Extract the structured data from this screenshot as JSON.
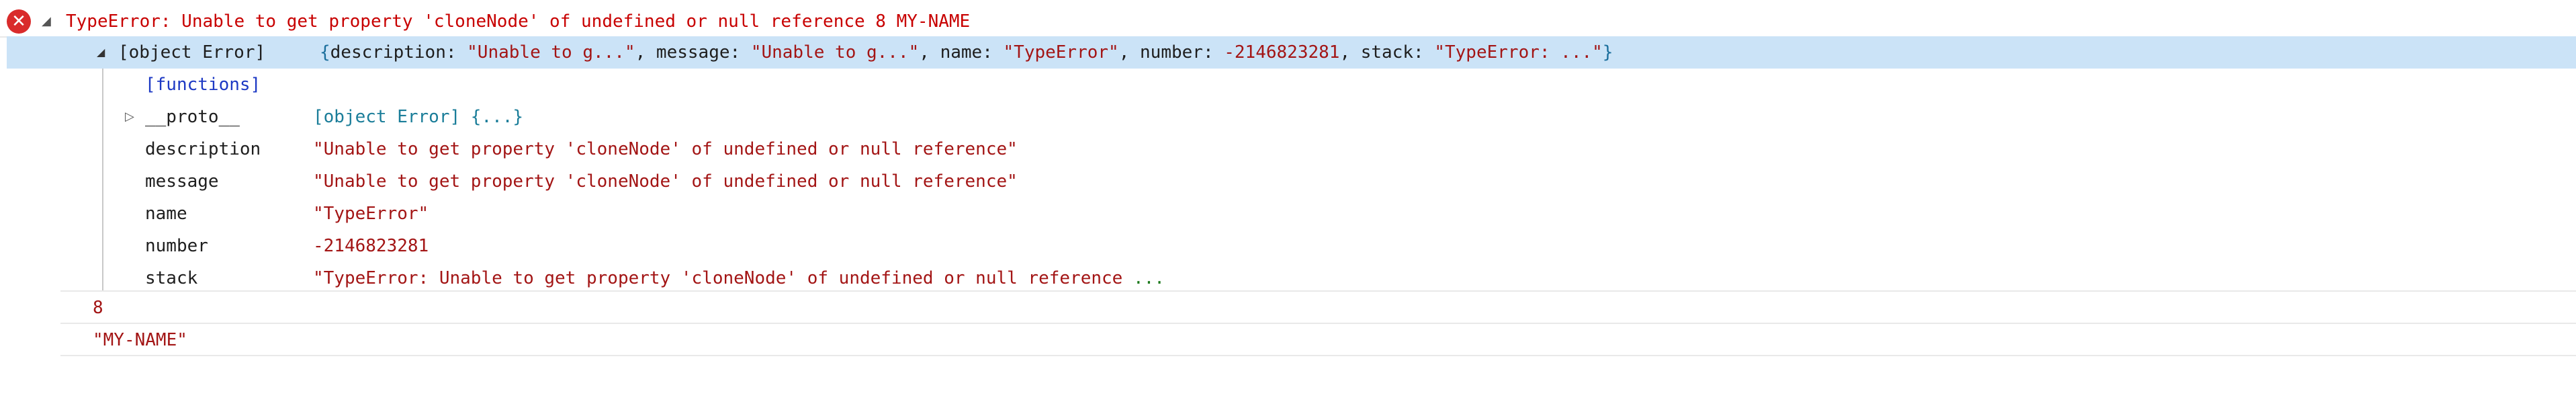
{
  "error": {
    "message": "TypeError: Unable to get property 'cloneNode' of undefined or null reference 8 MY-NAME",
    "icon": "error-circle-icon",
    "icon_glyph": "✕",
    "color": "#c80000"
  },
  "object": {
    "label": "[object Error]",
    "summary": {
      "open": "{",
      "close": "}",
      "entries": [
        {
          "key": "description",
          "value": "\"Unable to g...\""
        },
        {
          "key": "message",
          "value": "\"Unable to g...\""
        },
        {
          "key": "name",
          "value": "\"TypeError\""
        },
        {
          "key": "number",
          "value": "-2146823281"
        },
        {
          "key": "stack",
          "value": "\"TypeError: ...\""
        }
      ]
    },
    "functions_label": "[functions]",
    "proto": {
      "key": "__proto__",
      "value": "[object Error] {...}"
    },
    "properties": [
      {
        "key": "description",
        "value": "\"Unable to get property 'cloneNode' of undefined or null reference\""
      },
      {
        "key": "message",
        "value": "\"Unable to get property 'cloneNode' of undefined or null reference\""
      },
      {
        "key": "name",
        "value": "\"TypeError\""
      },
      {
        "key": "number",
        "value": "-2146823281"
      },
      {
        "key": "stack",
        "value": "\"TypeError: Unable to get property 'cloneNode' of undefined or null reference",
        "trail": " ..."
      }
    ]
  },
  "values": {
    "number": "8",
    "string": "\"MY-NAME\""
  },
  "colors": {
    "selection": "#cbe3f7",
    "error_text": "#c80000",
    "string": "#a31515",
    "functions": "#1d39c4",
    "proto": "#1a7d99"
  }
}
